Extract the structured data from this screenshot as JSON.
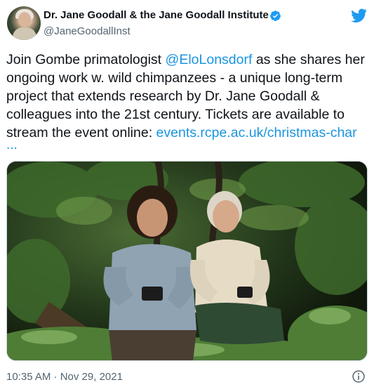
{
  "author": {
    "name": "Dr. Jane Goodall & the Jane Goodall Institute",
    "handle": "@JaneGoodallInst",
    "verified": true
  },
  "tweet": {
    "lines": [
      {
        "pre": "Join Gombe primatologist ",
        "mention": "@EloLonsdorf",
        "post": " as she shares her"
      },
      {
        "text": "ongoing work w. wild chimpanzees - a unique long-term"
      },
      {
        "text": "project that extends research by Dr. Jane Goodall &"
      },
      {
        "text": "colleagues into the 21st century. Tickets are available to"
      },
      {
        "pre": "stream the event online: ",
        "link": "events.rcpe.ac.uk/christmas-char"
      }
    ],
    "ellipsis": "..."
  },
  "meta": {
    "timestamp": "10:35 AM · Nov 29, 2021"
  },
  "icons": {
    "brand": "twitter-bird-icon",
    "verified": "verified-badge-icon",
    "info": "info-icon"
  },
  "colors": {
    "link": "#1b95e0",
    "verified": "#1d9bf0",
    "twitter": "#1d9bf0",
    "secondary_text": "#536471"
  }
}
